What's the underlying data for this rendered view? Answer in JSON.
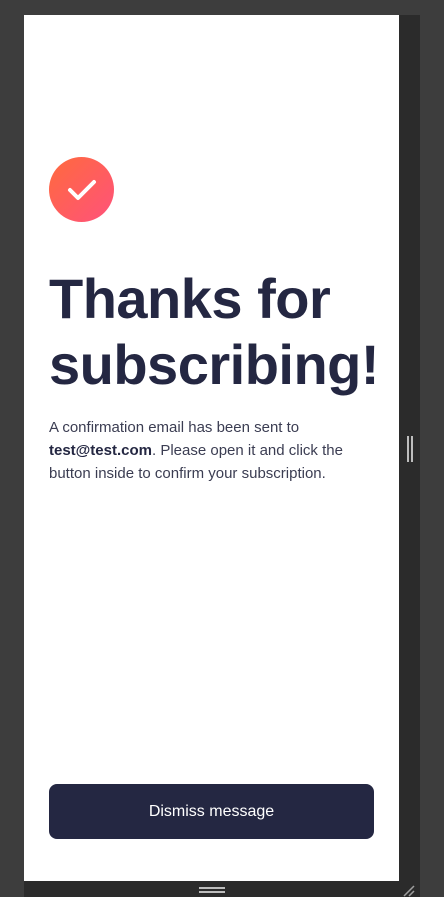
{
  "icons": {
    "success": "check-icon"
  },
  "colors": {
    "accent_start": "#ff6a3d",
    "accent_end": "#ff527b",
    "primary": "#242742",
    "background": "#ffffff"
  },
  "content": {
    "headline": "Thanks for subscribing!",
    "body_before_email": "A confirmation email has been sent to",
    "email": "test@test.com",
    "body_after_email": ". Please open it and click the button inside to confirm your subscription."
  },
  "actions": {
    "dismiss_label": "Dismiss message"
  }
}
